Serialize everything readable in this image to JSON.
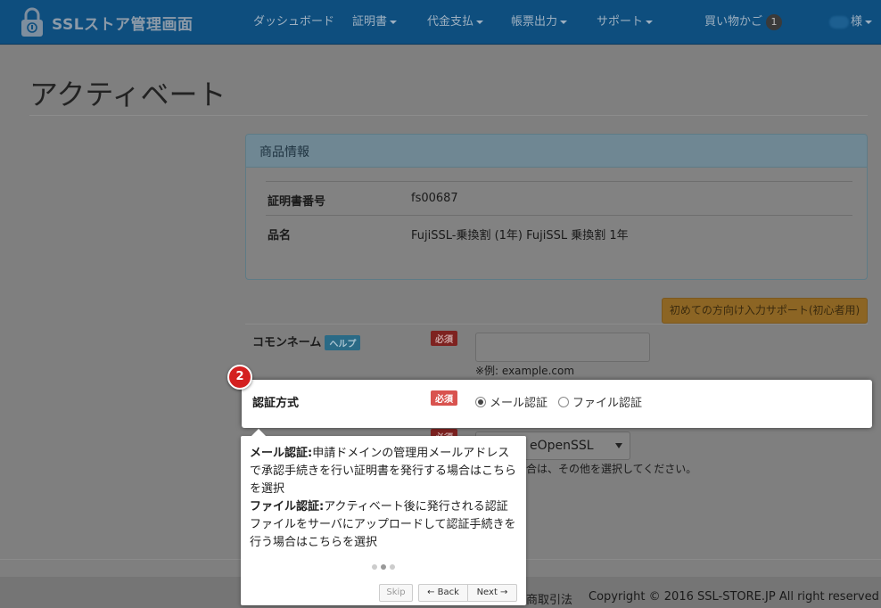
{
  "navbar": {
    "brand": "SSLストア管理画面",
    "items": [
      {
        "label": "ダッシュボード",
        "dropdown": false
      },
      {
        "label": "証明書",
        "dropdown": true
      },
      {
        "label": "代金支払",
        "dropdown": true
      },
      {
        "label": "帳票出力",
        "dropdown": true
      },
      {
        "label": "サポート",
        "dropdown": true
      }
    ],
    "cart_label": "買い物かご",
    "cart_count": "1",
    "user_suffix": "様"
  },
  "page": {
    "title": "アクティベート"
  },
  "product_panel": {
    "heading": "商品情報",
    "rows": [
      {
        "key": "証明書番号",
        "value": "fs00687"
      },
      {
        "key": "品名",
        "value": "FujiSSL-乗換割 (1年) FujiSSL 乗換割 1年"
      }
    ]
  },
  "form": {
    "beginner_button": "初めての方向け入力サポート(初心者用)",
    "required_tag": "必須",
    "help_tag": "ヘルプ",
    "common_name": {
      "label": "コモンネーム",
      "value": "",
      "hint": "※例: example.com"
    },
    "auth_method": {
      "label": "認証方式",
      "options": [
        "メール認証",
        "ファイル認証"
      ],
      "selected": "メール認証"
    },
    "server_type": {
      "select_value": "eOpenSSL",
      "note": "合は、その他を選択してください。"
    }
  },
  "tour": {
    "step": "2",
    "mail_title": "メール認証:",
    "mail_text": "申請ドメインの管理用メールアドレスで承認手続きを行い証明書を発行する場合はこちらを選択",
    "file_title": "ファイル認証:",
    "file_text": "アクティベート後に発行される認証ファイルをサーバにアップロードして認証手続きを行う場合はこちらを選択",
    "skip": "Skip",
    "back": "← Back",
    "next": "Next →"
  },
  "footer": {
    "law_link": "商取引法",
    "copyright": "Copyright © 2016 SSL-STORE.JP All right reserved"
  }
}
